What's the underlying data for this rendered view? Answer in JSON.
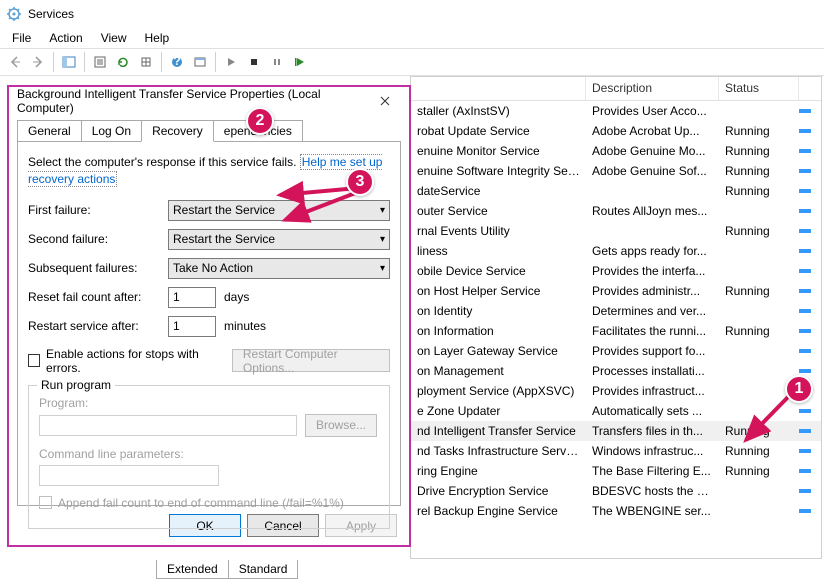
{
  "window": {
    "title": "Services"
  },
  "menu": {
    "file": "File",
    "action": "Action",
    "view": "View",
    "help": "Help"
  },
  "dialog": {
    "title": "Background Intelligent Transfer Service Properties (Local Computer)",
    "tabs": {
      "general": "General",
      "logon": "Log On",
      "recovery": "Recovery",
      "dependencies": "      ependencies"
    },
    "intro": "Select the computer's response if this service fails.",
    "help_link": "Help me set up recovery actions",
    "labels": {
      "first": "First failure:",
      "second": "Second failure:",
      "subsequent": "Subsequent failures:",
      "reset": "Reset fail count after:",
      "restart": "Restart service after:",
      "days": "days",
      "minutes": "minutes",
      "enable": "Enable actions for stops with errors.",
      "restart_opts": "Restart Computer Options...",
      "run_program": "Run program",
      "program": "Program:",
      "browse": "Browse...",
      "cmdline": "Command line parameters:",
      "append": "Append fail count to end of command line (/fail=%1%)"
    },
    "values": {
      "first": "Restart the Service",
      "second": "Restart the Service",
      "subsequent": "Take No Action",
      "reset_days": "1",
      "restart_min": "1"
    },
    "buttons": {
      "ok": "OK",
      "cancel": "Cancel",
      "apply": "Apply"
    }
  },
  "columns": {
    "description": "Description",
    "status": "Status"
  },
  "services": [
    {
      "name": "staller (AxInstSV)",
      "desc": "Provides User Acco...",
      "status": ""
    },
    {
      "name": "robat Update Service",
      "desc": "Adobe Acrobat Up...",
      "status": "Running"
    },
    {
      "name": "enuine Monitor Service",
      "desc": "Adobe Genuine Mo...",
      "status": "Running"
    },
    {
      "name": "enuine Software Integrity Service",
      "desc": "Adobe Genuine Sof...",
      "status": "Running"
    },
    {
      "name": "dateService",
      "desc": "",
      "status": "Running"
    },
    {
      "name": "outer Service",
      "desc": "Routes AllJoyn mes...",
      "status": ""
    },
    {
      "name": "rnal Events Utility",
      "desc": "",
      "status": "Running"
    },
    {
      "name": "liness",
      "desc": "Gets apps ready for...",
      "status": ""
    },
    {
      "name": "obile Device Service",
      "desc": "Provides the interfa...",
      "status": ""
    },
    {
      "name": "on Host Helper Service",
      "desc": "Provides administr...",
      "status": "Running"
    },
    {
      "name": "on Identity",
      "desc": "Determines and ver...",
      "status": ""
    },
    {
      "name": "on Information",
      "desc": "Facilitates the runni...",
      "status": "Running"
    },
    {
      "name": "on Layer Gateway Service",
      "desc": "Provides support fo...",
      "status": ""
    },
    {
      "name": "on Management",
      "desc": "Processes installati...",
      "status": ""
    },
    {
      "name": "ployment Service (AppXSVC)",
      "desc": "Provides infrastruct...",
      "status": ""
    },
    {
      "name": "e Zone Updater",
      "desc": "Automatically sets ...",
      "status": ""
    },
    {
      "name": "nd Intelligent Transfer Service",
      "desc": "Transfers files in th...",
      "status": "Running",
      "selected": true
    },
    {
      "name": "nd Tasks Infrastructure Service",
      "desc": "Windows infrastruc...",
      "status": "Running"
    },
    {
      "name": "ring Engine",
      "desc": "The Base Filtering E...",
      "status": "Running"
    },
    {
      "name": "Drive Encryption Service",
      "desc": "BDESVC hosts the B...",
      "status": ""
    },
    {
      "name": "rel Backup Engine Service",
      "desc": "The WBENGINE ser...",
      "status": ""
    }
  ],
  "bottom_tabs": {
    "extended": "Extended",
    "standard": "Standard"
  },
  "annotations": {
    "a1": "1",
    "a2": "2",
    "a3": "3"
  }
}
